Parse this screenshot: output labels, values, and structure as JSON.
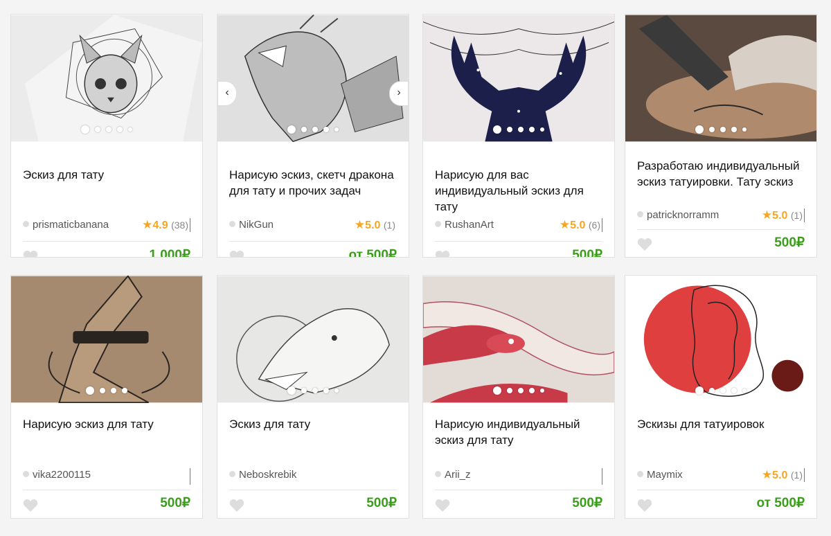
{
  "cards": [
    {
      "title": "Эскиз для тату",
      "seller": "prismaticbanana",
      "rating": "4.9",
      "reviews": "(38)",
      "price": "1 000₽",
      "colors": {
        "bg": "#e8e8e8",
        "ink": "#333333"
      }
    },
    {
      "title": "Нарисую эскиз, скетч дракона для тату и прочих задач",
      "seller": "NikGun",
      "rating": "5.0",
      "reviews": "(1)",
      "price": "от 500₽",
      "colors": {
        "bg": "#dcdcdc",
        "ink": "#444444"
      }
    },
    {
      "title": "Нарисую для вас индивидуальный эскиз для тату",
      "seller": "RushanArt",
      "rating": "5.0",
      "reviews": "(6)",
      "price": "500₽",
      "colors": {
        "bg": "#e9e4e6",
        "ink": "#1c1f4a"
      }
    },
    {
      "title": "Разработаю индивидуальный эскиз татуировки. Тату эскиз",
      "seller": "patricknorramm",
      "rating": "5.0",
      "reviews": "(1)",
      "price": "500₽",
      "colors": {
        "bg": "#6a5b4f",
        "ink": "#c9a98c"
      }
    },
    {
      "title": "Нарисую эскиз для тату",
      "seller": "vika2200115",
      "rating": "",
      "reviews": "",
      "price": "500₽",
      "colors": {
        "bg": "#a88b70",
        "ink": "#2a2420"
      }
    },
    {
      "title": "Эскиз для тату",
      "seller": "Neboskrebik",
      "rating": "",
      "reviews": "",
      "price": "500₽",
      "colors": {
        "bg": "#e6e6e4",
        "ink": "#444444"
      }
    },
    {
      "title": "Нарисую индивидуальный эскиз для тату",
      "seller": "Arii_z",
      "rating": "",
      "reviews": "",
      "price": "500₽",
      "colors": {
        "bg": "#e4ddd8",
        "ink": "#c83a48"
      }
    },
    {
      "title": "Эскизы для татуировок",
      "seller": "Maymix",
      "rating": "5.0",
      "reviews": "(1)",
      "price": "от 500₽",
      "colors": {
        "bg": "#ffffff",
        "ink": "#d93b3b"
      }
    }
  ],
  "carousel": {
    "prev_icon": "chevron-left-icon",
    "next_icon": "chevron-right-icon"
  }
}
